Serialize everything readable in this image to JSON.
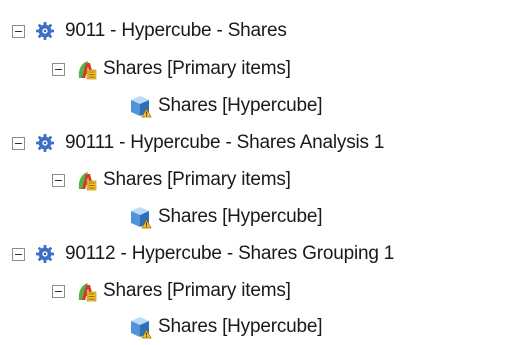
{
  "tree": {
    "groups": [
      {
        "label": "9011 - Hypercube - Shares",
        "child_label": "Shares [Primary items]",
        "grandchild_label": "Shares [Hypercube]"
      },
      {
        "label": "90111 - Hypercube - Shares Analysis 1",
        "child_label": "Shares [Primary items]",
        "grandchild_label": "Shares [Hypercube]"
      },
      {
        "label": "90112 - Hypercube - Shares Grouping 1",
        "child_label": "Shares [Primary items]",
        "grandchild_label": "Shares [Hypercube]"
      }
    ],
    "icons": {
      "group": "gear-icon",
      "primary_items": "primary-items-icon",
      "hypercube": "hypercube-icon",
      "toggle": "collapse-minus-icon"
    },
    "colors": {
      "gear": "#3f6fc4",
      "cube": "#4f93d8",
      "accent_red": "#d03a2a",
      "accent_yellow": "#f2c12e",
      "leaf_green": "#58b04b"
    }
  }
}
